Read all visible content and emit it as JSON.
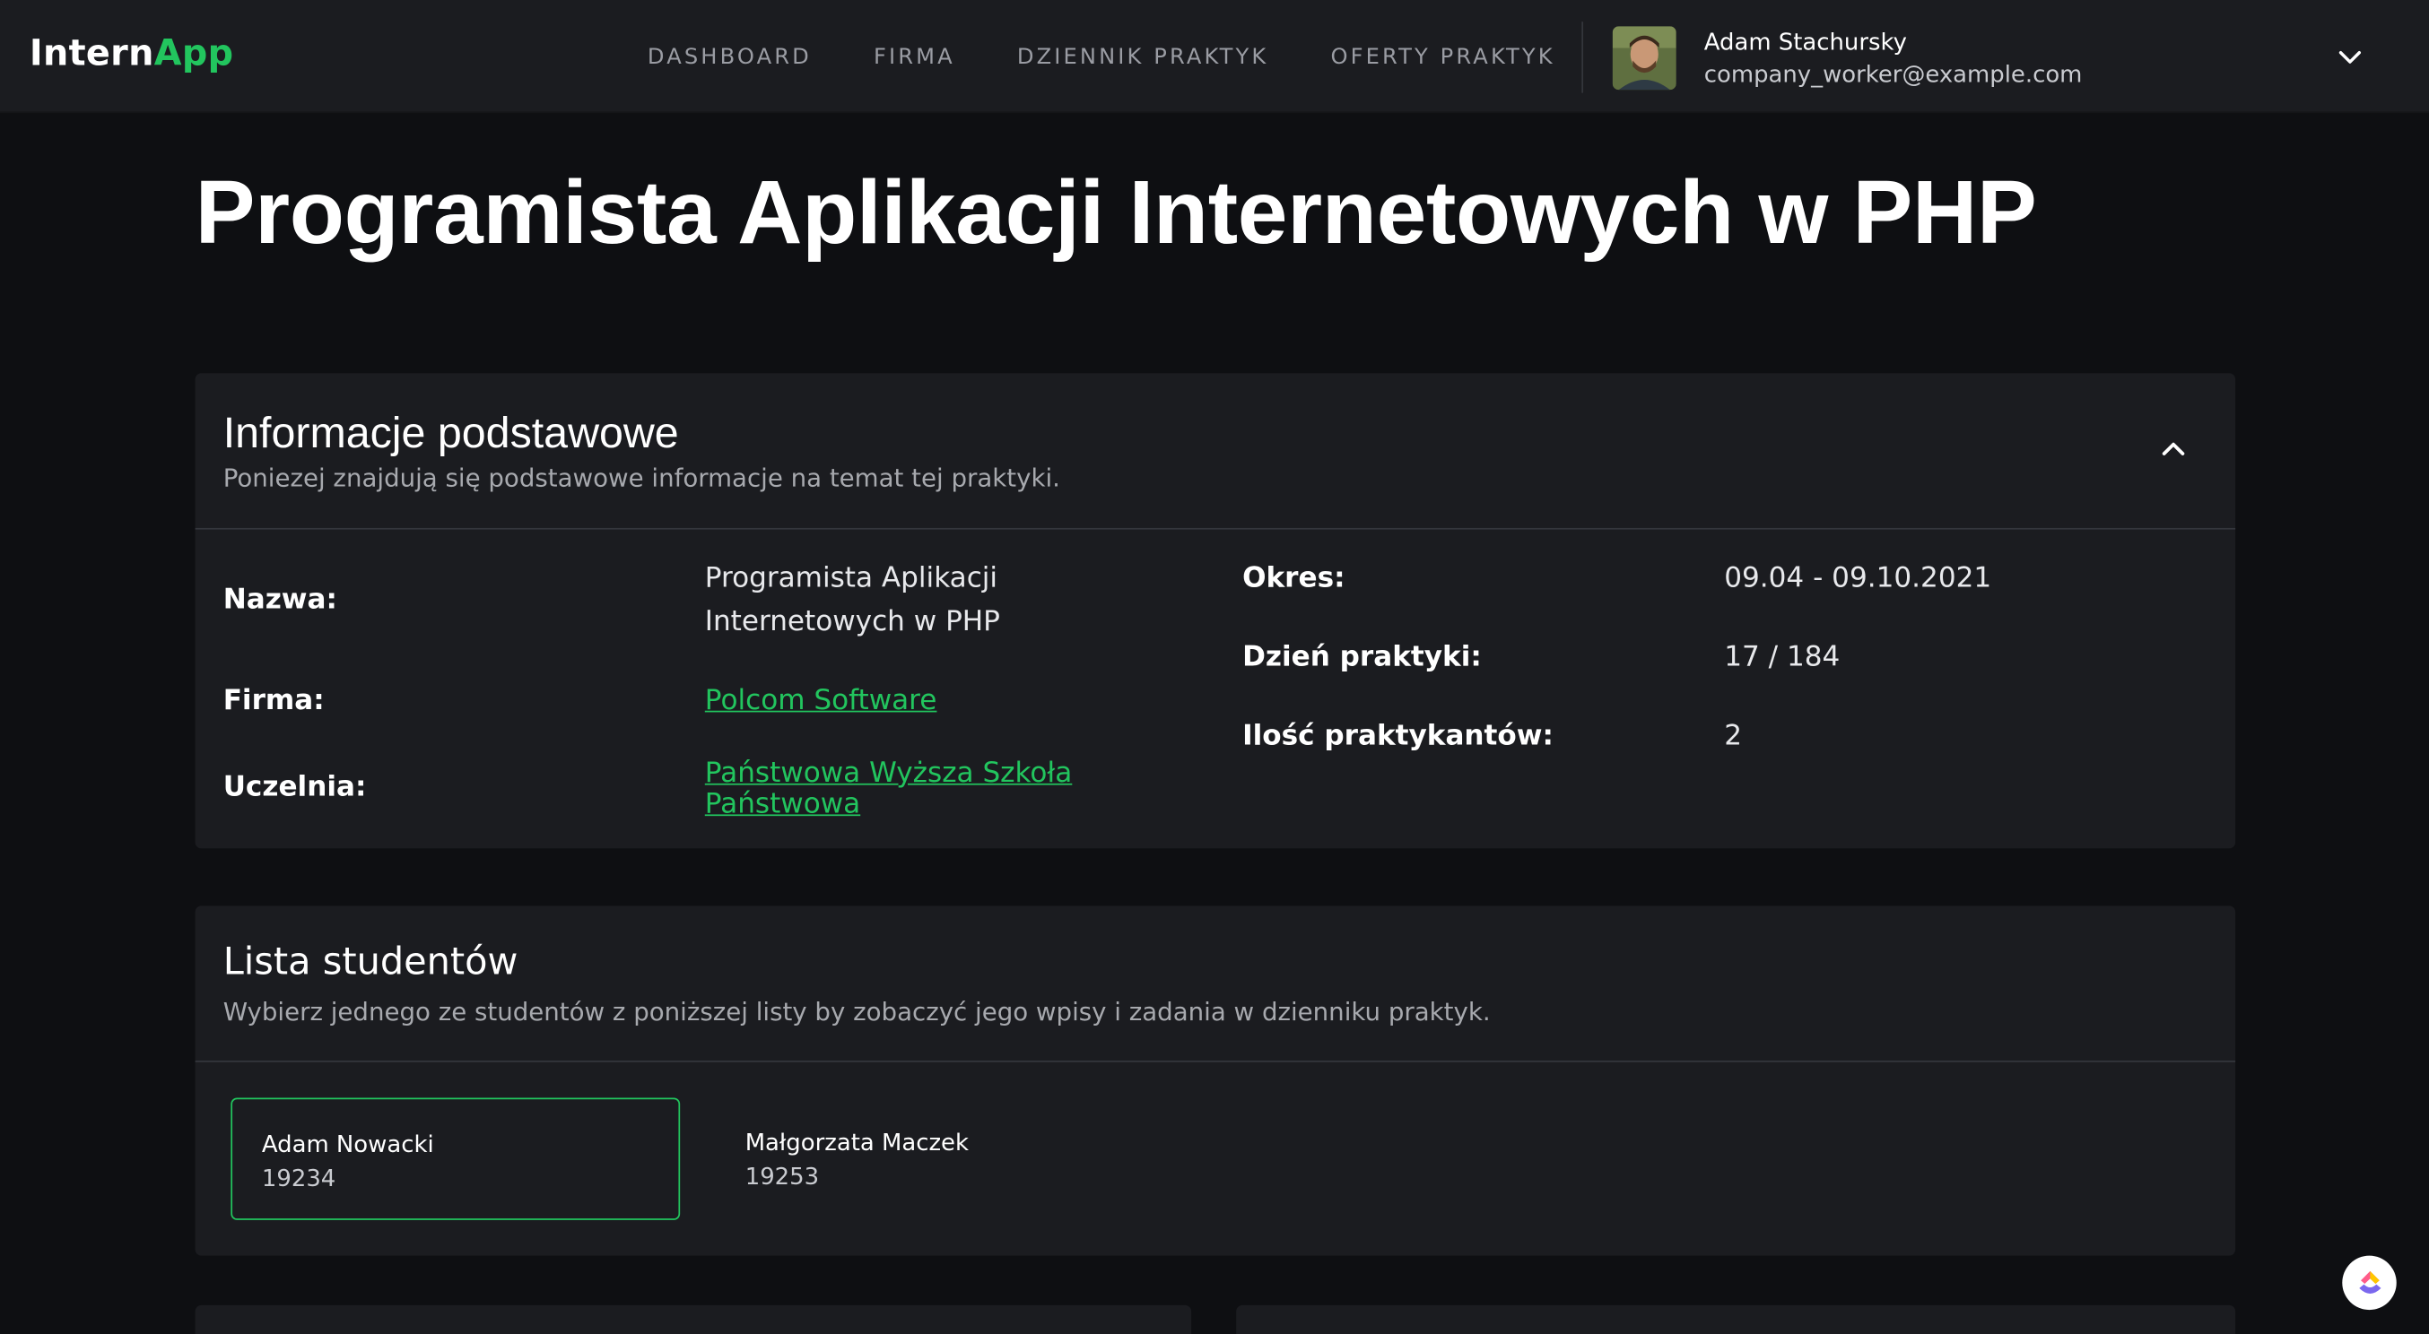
{
  "brand": {
    "part1": "Intern",
    "part2": "App",
    "accent": "#22c55e"
  },
  "nav": {
    "items": [
      {
        "label": "DASHBOARD"
      },
      {
        "label": "FIRMA"
      },
      {
        "label": "DZIENNIK PRAKTYK"
      },
      {
        "label": "OFERTY PRAKTYK"
      }
    ]
  },
  "user": {
    "name": "Adam Stachursky",
    "email": "company_worker@example.com",
    "avatar_icon": "user-avatar-photo",
    "menu_icon": "chevron-down-icon"
  },
  "page": {
    "title": "Programista Aplikacji Internetowych w PHP"
  },
  "info": {
    "title": "Informacje podstawowe",
    "subtitle": "Poniezej znajdują się podstawowe informacje na temat tej praktyki.",
    "collapse_icon": "chevron-up-icon",
    "fields": {
      "name_label": "Nazwa:",
      "name_value_line1": "Programista Aplikacji",
      "name_value_line2": "Internetowych w PHP",
      "company_label": "Firma:",
      "company_value": "Polcom Software",
      "university_label": "Uczelnia:",
      "university_value_line1": "Państwowa Wyższa Szkoła",
      "university_value_line2": "Państwowa",
      "period_label": "Okres:",
      "period_value": "09.04 - 09.10.2021",
      "day_label": "Dzień praktyki:",
      "day_value": "17 / 184",
      "interns_label": "Ilość praktykantów:",
      "interns_value": "2"
    }
  },
  "students": {
    "title": "Lista studentów",
    "subtitle": "Wybierz jednego ze studentów z poniższej listy by zobaczyć jego wpisy i zadania w dzienniku praktyk.",
    "items": [
      {
        "name": "Adam Nowacki",
        "id": "19234",
        "selected": true
      },
      {
        "name": "Małgorzata Maczek",
        "id": "19253",
        "selected": false
      }
    ]
  },
  "fab": {
    "icon": "clickup-logo-icon"
  }
}
